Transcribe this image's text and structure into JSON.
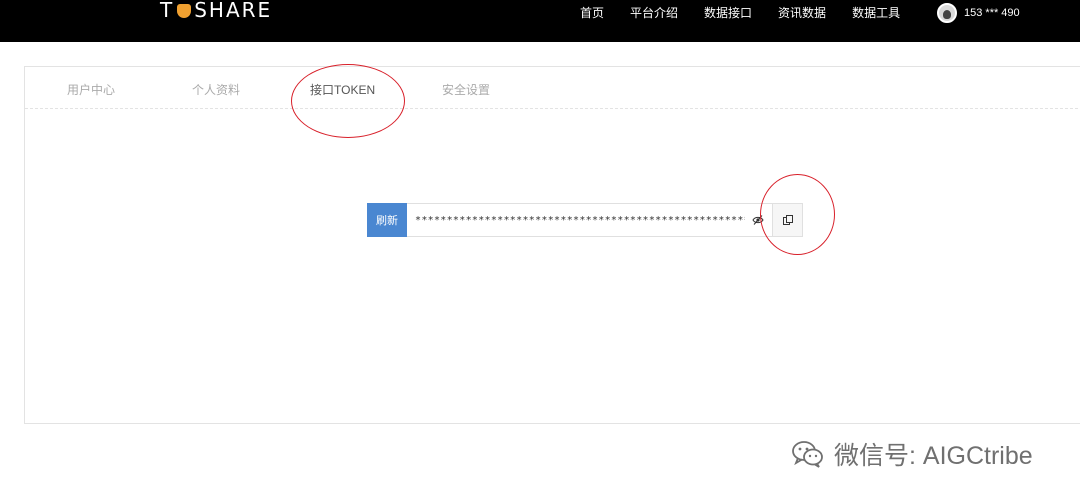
{
  "header": {
    "logo_text_before": "T",
    "logo_text_after": "SHARE",
    "nav": [
      "首页",
      "平台介绍",
      "数据接口",
      "资讯数据",
      "数据工具"
    ],
    "user_phone": "153 *** 490",
    "avatar_icon": "user-avatar-icon"
  },
  "tabs": [
    {
      "label": "用户中心",
      "active": false
    },
    {
      "label": "个人资料",
      "active": false
    },
    {
      "label": "接口TOKEN",
      "active": true
    },
    {
      "label": "安全设置",
      "active": false
    }
  ],
  "token": {
    "refresh_label": "刷新",
    "masked_value": "**************************************************************",
    "eye_icon": "eye-icon",
    "copy_icon": "copy-icon"
  },
  "colors": {
    "header_bg": "#000000",
    "refresh_btn": "#4a87d1",
    "annotation_red": "#d8202a"
  },
  "watermark": {
    "icon": "wechat-icon",
    "text": "微信号: AIGCtribe"
  }
}
